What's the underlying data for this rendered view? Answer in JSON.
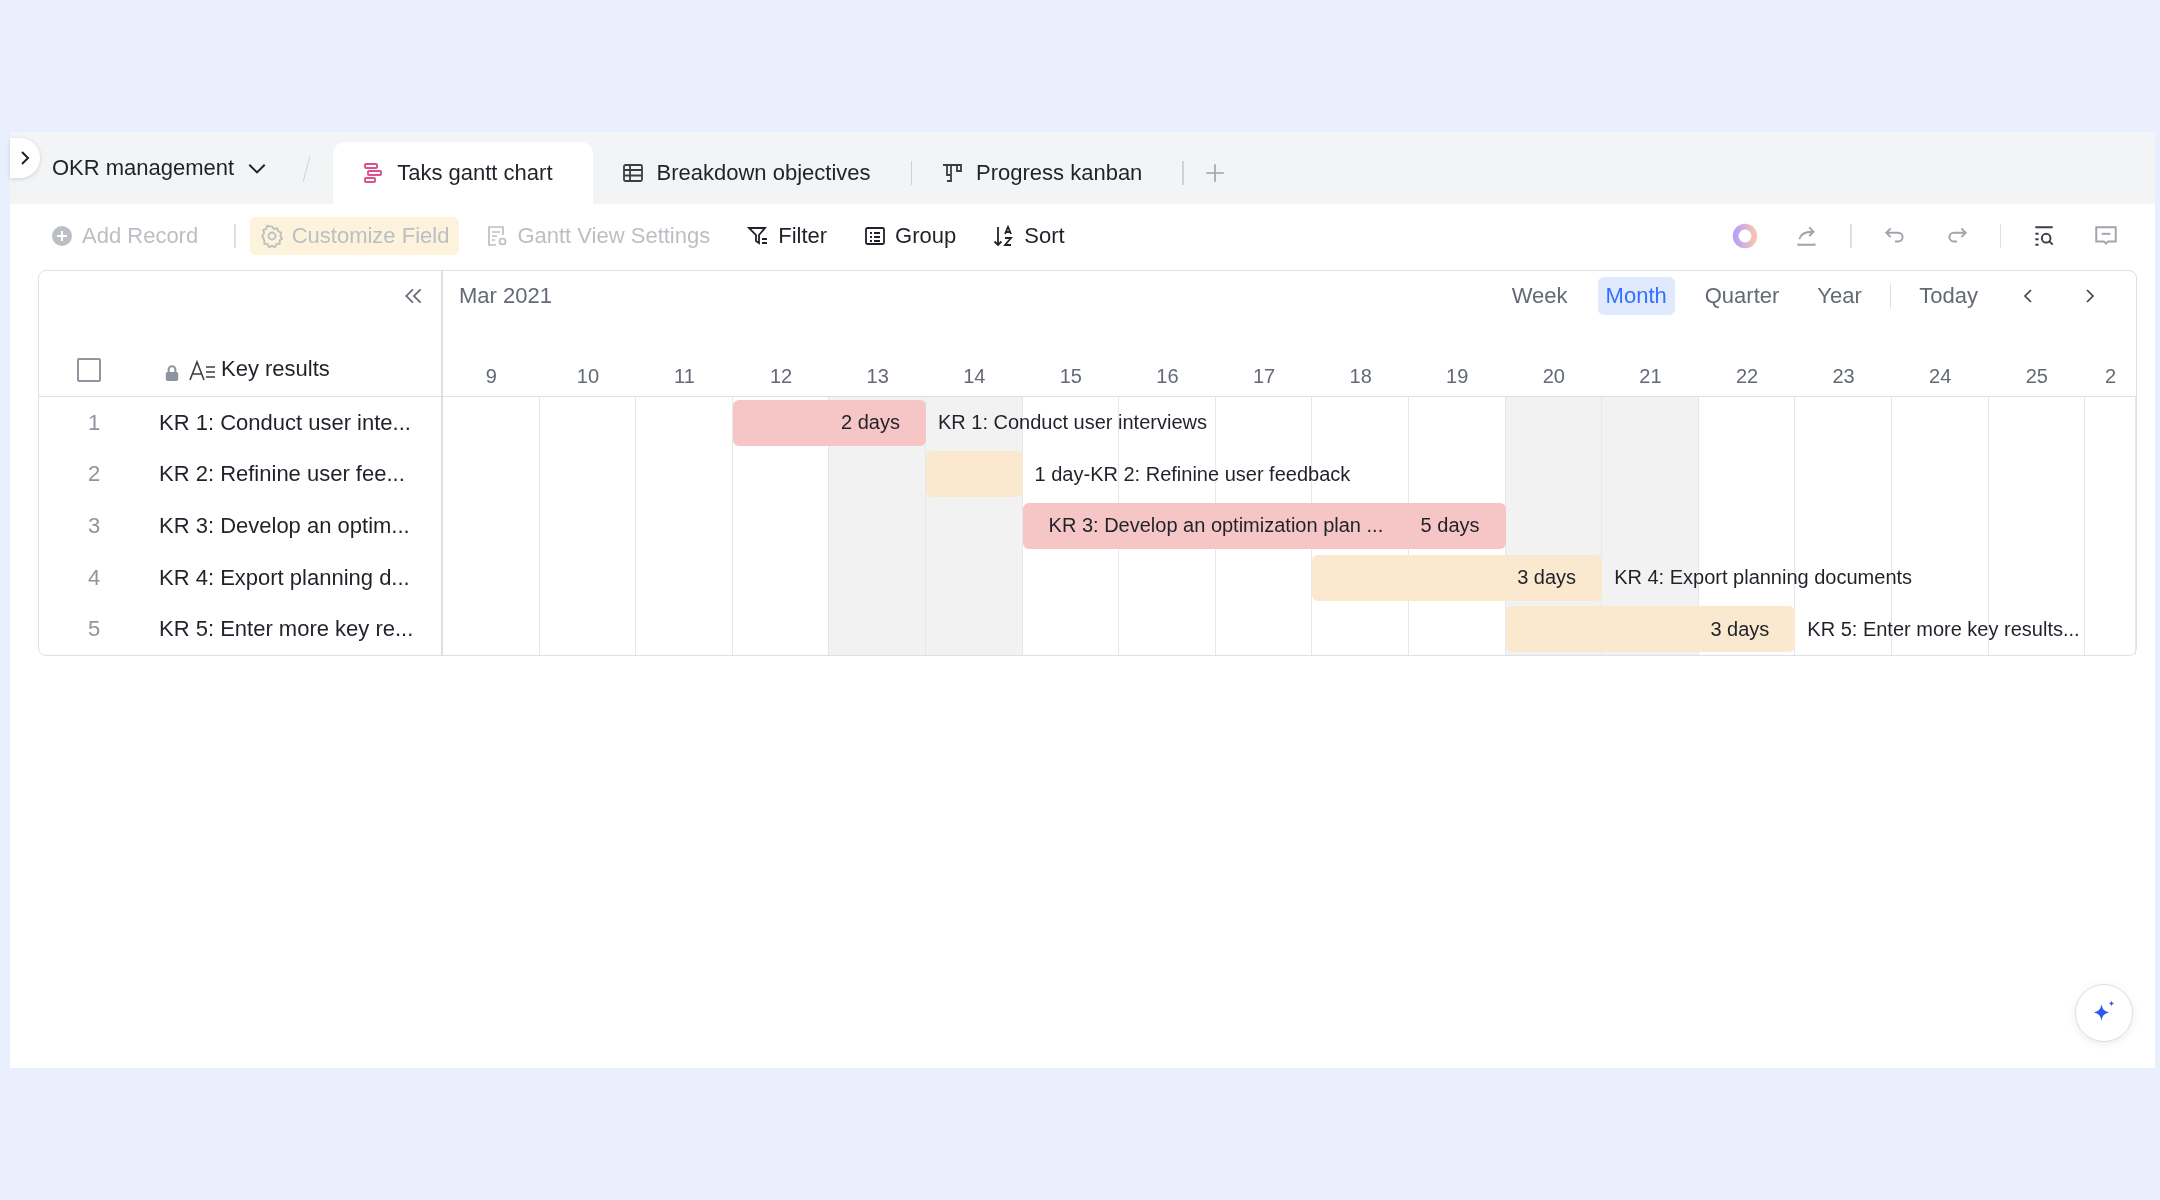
{
  "breadcrumb": {
    "title": "OKR management"
  },
  "tabs": [
    {
      "label": "Taks gantt chart",
      "kind": "gantt",
      "selected": true
    },
    {
      "label": "Breakdown objectives",
      "kind": "grid",
      "selected": false
    },
    {
      "label": "Progress kanban",
      "kind": "kanban",
      "selected": false
    }
  ],
  "toolbar": [
    {
      "label": "Add Record",
      "kind": "add",
      "disabled": true,
      "highlighted": false
    },
    {
      "label": "Customize Field",
      "kind": "gear",
      "disabled": true,
      "highlighted": true
    },
    {
      "label": "Gantt View Settings",
      "kind": "settings",
      "disabled": true,
      "highlighted": false
    },
    {
      "label": "Filter",
      "kind": "filter",
      "disabled": false,
      "highlighted": false
    },
    {
      "label": "Group",
      "kind": "group",
      "disabled": false,
      "highlighted": false
    },
    {
      "label": "Sort",
      "kind": "sort",
      "disabled": false,
      "highlighted": false
    }
  ],
  "gantt": {
    "month": "Mar 2021",
    "views": [
      {
        "label": "Week",
        "selected": false
      },
      {
        "label": "Month",
        "selected": true
      },
      {
        "label": "Quarter",
        "selected": false
      },
      {
        "label": "Year",
        "selected": false
      }
    ],
    "today": "Today",
    "select_all": {
      "checked": false
    },
    "column_header": "Key results",
    "days": [
      {
        "label": "9",
        "weekend": false
      },
      {
        "label": "10",
        "weekend": false
      },
      {
        "label": "11",
        "weekend": false
      },
      {
        "label": "12",
        "weekend": false
      },
      {
        "label": "13",
        "weekend": true
      },
      {
        "label": "14",
        "weekend": true
      },
      {
        "label": "15",
        "weekend": false
      },
      {
        "label": "16",
        "weekend": false
      },
      {
        "label": "17",
        "weekend": false
      },
      {
        "label": "18",
        "weekend": false
      },
      {
        "label": "19",
        "weekend": false
      },
      {
        "label": "20",
        "weekend": true
      },
      {
        "label": "21",
        "weekend": true
      },
      {
        "label": "22",
        "weekend": false
      },
      {
        "label": "23",
        "weekend": false
      },
      {
        "label": "24",
        "weekend": false
      },
      {
        "label": "25",
        "weekend": false
      },
      {
        "label": "2",
        "weekend": false
      }
    ],
    "rows": [
      {
        "number": "1",
        "name": "KR 1: Conduct user inte...",
        "color": "#f5c6c5",
        "bar_duration": "2 days",
        "label": "KR 1: Conduct user interviews"
      },
      {
        "number": "2",
        "name": "KR 2: Refinine user fee...",
        "color": "#fae8cf",
        "label": "1 day-KR 2: Refinine user feedback"
      },
      {
        "number": "3",
        "name": "KR 3: Develop an optim...",
        "color": "#f5c6c5",
        "bar_title": "KR 3: Develop an optimization plan ...",
        "bar_duration": "5 days"
      },
      {
        "number": "4",
        "name": "KR 4: Export planning d...",
        "color": "#fae8cf",
        "bar_duration": "3 days",
        "label": "KR 4: Export planning documents"
      },
      {
        "number": "5",
        "name": "KR 5: Enter more key re...",
        "color": "#fae8cf",
        "bar_duration": "3 days",
        "label": "KR 5: Enter more key results..."
      }
    ]
  }
}
